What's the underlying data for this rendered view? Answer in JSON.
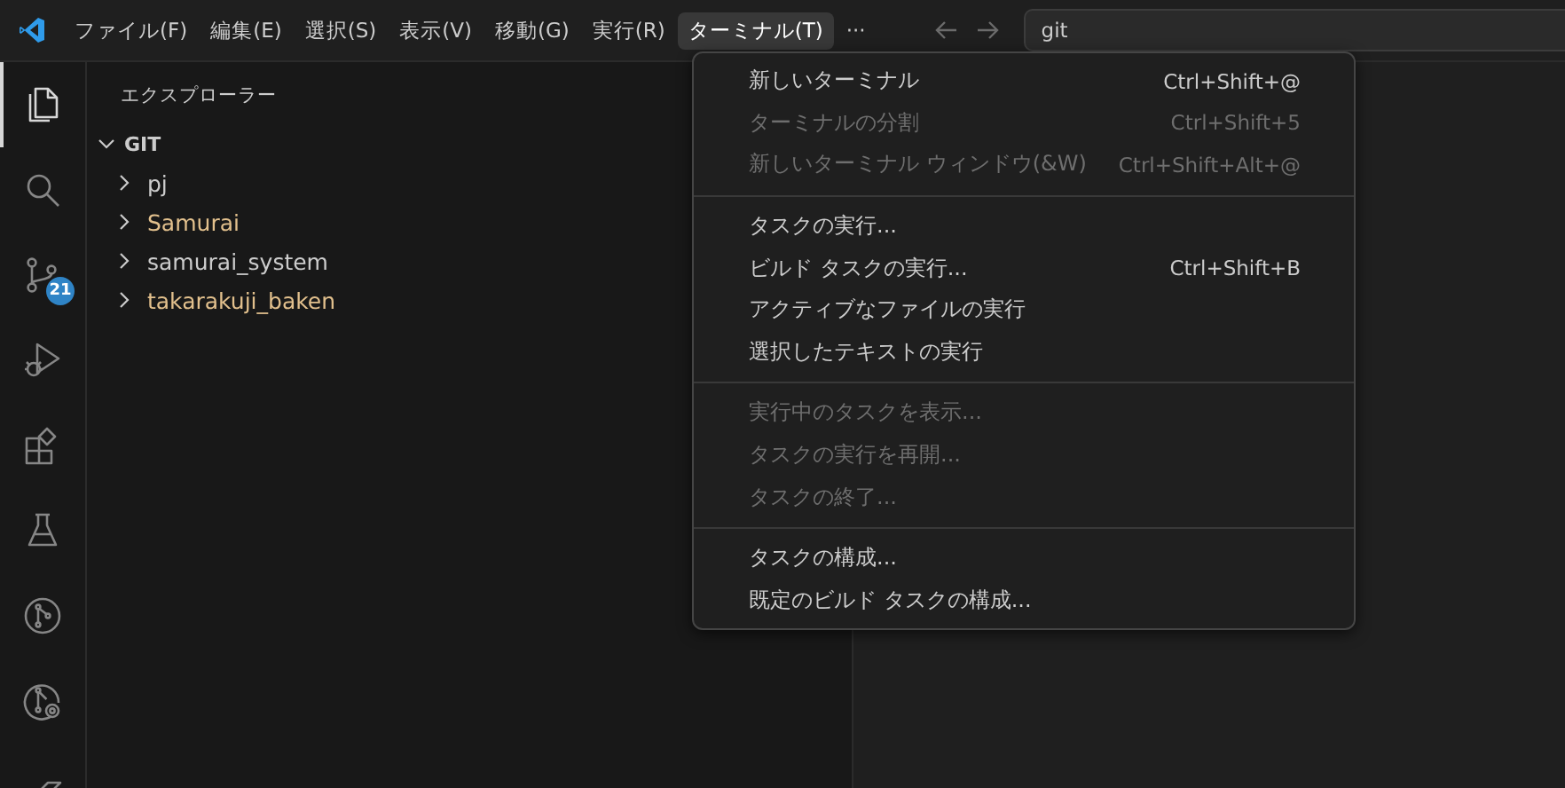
{
  "menu_bar": {
    "items": [
      {
        "label": "ファイル(F)",
        "selected": false
      },
      {
        "label": "編集(E)",
        "selected": false
      },
      {
        "label": "選択(S)",
        "selected": false
      },
      {
        "label": "表示(V)",
        "selected": false
      },
      {
        "label": "移動(G)",
        "selected": false
      },
      {
        "label": "実行(R)",
        "selected": false
      },
      {
        "label": "ターミナル(T)",
        "selected": true
      },
      {
        "label": "···",
        "selected": false
      }
    ],
    "search": {
      "value": "git"
    }
  },
  "activity_bar": [
    {
      "kind": "files",
      "selected": true
    },
    {
      "kind": "search",
      "selected": false
    },
    {
      "kind": "branches",
      "selected": false,
      "badge": "21"
    },
    {
      "kind": "debug",
      "selected": false
    },
    {
      "kind": "extensions",
      "selected": false
    },
    {
      "kind": "flask",
      "selected": false
    },
    {
      "kind": "graph",
      "selected": false
    },
    {
      "kind": "graph-search",
      "selected": false
    },
    {
      "kind": "pen",
      "selected": false
    }
  ],
  "explorer": {
    "title": "エクスプローラー",
    "section": {
      "label": "GIT",
      "expanded": true,
      "items": [
        {
          "label": "pj",
          "expanded": false,
          "color": "#cccccc"
        },
        {
          "label": "Samurai",
          "expanded": false,
          "color": "#e2c08d"
        },
        {
          "label": "samurai_system",
          "expanded": false,
          "color": "#cccccc"
        },
        {
          "label": "takarakuji_baken",
          "expanded": false,
          "color": "#e2c08d"
        }
      ]
    }
  },
  "terminal_menu": {
    "groups": [
      [
        {
          "label": "新しいターミナル",
          "shortcut": "Ctrl+Shift+@",
          "disabled": false
        },
        {
          "label": "ターミナルの分割",
          "shortcut": "Ctrl+Shift+5",
          "disabled": true
        },
        {
          "label": "新しいターミナル ウィンドウ(&W)",
          "shortcut": "Ctrl+Shift+Alt+@",
          "disabled": true
        }
      ],
      [
        {
          "label": "タスクの実行...",
          "disabled": false
        },
        {
          "label": "ビルド タスクの実行...",
          "shortcut": "Ctrl+Shift+B",
          "disabled": false
        },
        {
          "label": "アクティブなファイルの実行",
          "disabled": false
        },
        {
          "label": "選択したテキストの実行",
          "disabled": false
        }
      ],
      [
        {
          "label": "実行中のタスクを表示...",
          "disabled": true
        },
        {
          "label": "タスクの実行を再開...",
          "disabled": true
        },
        {
          "label": "タスクの終了...",
          "disabled": true
        }
      ],
      [
        {
          "label": "タスクの構成...",
          "disabled": false
        },
        {
          "label": "既定のビルド タスクの構成...",
          "disabled": false
        }
      ]
    ]
  }
}
